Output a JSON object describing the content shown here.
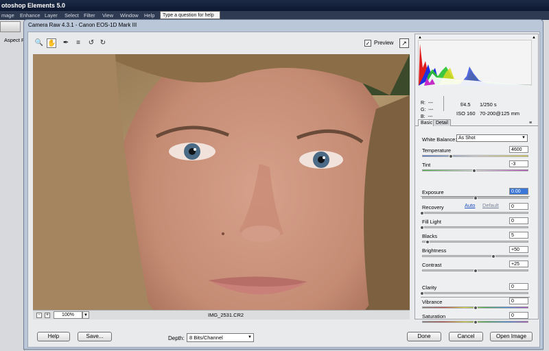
{
  "pse": {
    "title": "otoshop Elements 5.0",
    "menu": [
      "mage",
      "Enhance",
      "Layer",
      "Select",
      "Filter",
      "View",
      "Window",
      "Help"
    ],
    "help_placeholder": "Type a question for help",
    "left_label": "Aspect Ra"
  },
  "dialog": {
    "title": "Camera Raw 4.3.1  -  Canon EOS-1D Mark III",
    "preview_label": "Preview",
    "filename": "IMG_2531.CR2",
    "zoom": "100%",
    "buttons": {
      "help": "Help",
      "save": "Save...",
      "done": "Done",
      "cancel": "Cancel",
      "open": "Open Image"
    },
    "depth_label": "Depth:",
    "depth_value": "8 Bits/Channel"
  },
  "readout": {
    "r": "R:",
    "g": "G:",
    "b": "B:",
    "dash": "---"
  },
  "exif": {
    "aperture": "f/4.5",
    "shutter": "1/250 s",
    "iso": "ISO 160",
    "lens": "70-200@125 mm"
  },
  "tabs": [
    "Basic",
    "Detail"
  ],
  "basic": {
    "wb_label": "White Balance:",
    "wb_value": "As Shot",
    "auto": "Auto",
    "default": "Default",
    "sliders": [
      {
        "label": "Temperature",
        "value": "4600",
        "pos": 0.27
      },
      {
        "label": "Tint",
        "value": "-3",
        "pos": 0.49
      },
      {
        "label": "Exposure",
        "value": "0.00",
        "pos": 0.5
      },
      {
        "label": "Recovery",
        "value": "0",
        "pos": 0.0
      },
      {
        "label": "Fill Light",
        "value": "0",
        "pos": 0.0
      },
      {
        "label": "Blacks",
        "value": "5",
        "pos": 0.05
      },
      {
        "label": "Brightness",
        "value": "+50",
        "pos": 0.67
      },
      {
        "label": "Contrast",
        "value": "+25",
        "pos": 0.5
      },
      {
        "label": "Clarity",
        "value": "0",
        "pos": 0.0
      },
      {
        "label": "Vibrance",
        "value": "0",
        "pos": 0.5
      },
      {
        "label": "Saturation",
        "value": "0",
        "pos": 0.5
      }
    ]
  }
}
